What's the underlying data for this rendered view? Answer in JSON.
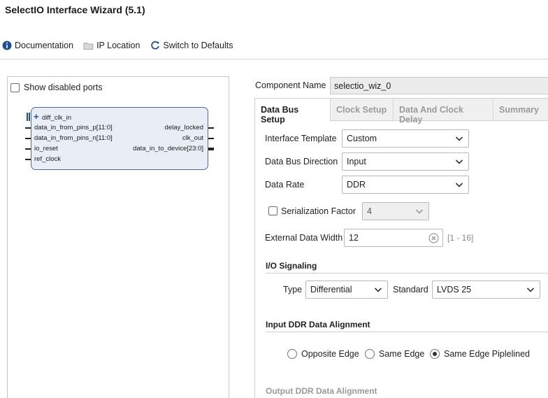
{
  "window": {
    "title": "SelectIO Interface Wizard (5.1)"
  },
  "toolbar": {
    "documentation": "Documentation",
    "ip_location": "IP Location",
    "switch_defaults": "Switch to Defaults"
  },
  "left": {
    "show_disabled_ports": "Show disabled ports",
    "show_disabled_checked": false,
    "ports_left": [
      "diff_clk_in",
      "data_in_from_pins_p[11:0]",
      "data_in_from_pins_n[11:0]",
      "io_reset",
      "ref_clock"
    ],
    "ports_right": [
      "delay_locked",
      "clk_out",
      "data_in_to_device[23:0]"
    ],
    "expand_symbol": "+"
  },
  "component": {
    "label": "Component Name",
    "value": "selectio_wiz_0"
  },
  "tabs": [
    "Data Bus Setup",
    "Clock Setup",
    "Data And Clock Delay",
    "Summary"
  ],
  "active_tab": 0,
  "form": {
    "interface_template": {
      "label": "Interface Template",
      "value": "Custom"
    },
    "data_bus_direction": {
      "label": "Data Bus Direction",
      "value": "Input"
    },
    "data_rate": {
      "label": "Data Rate",
      "value": "DDR"
    },
    "serialization_factor": {
      "label": "Serialization Factor",
      "value": "4",
      "checked": false
    },
    "external_data_width": {
      "label": "External Data Width",
      "value": "12",
      "range": "[1 - 16]"
    }
  },
  "io_signaling": {
    "heading": "I/O Signaling",
    "type_label": "Type",
    "type_value": "Differential",
    "standard_label": "Standard",
    "standard_value": "LVDS 25"
  },
  "input_ddr": {
    "heading": "Input DDR Data Alignment",
    "options": [
      "Opposite Edge",
      "Same Edge",
      "Same Edge Piplelined"
    ],
    "selected": 2
  },
  "output_ddr": {
    "heading": "Output DDR Data Alignment"
  },
  "colors": {
    "block_fill": "#e9eef6",
    "block_border": "#4b6d98",
    "info_blue": "#1f5fa8"
  }
}
